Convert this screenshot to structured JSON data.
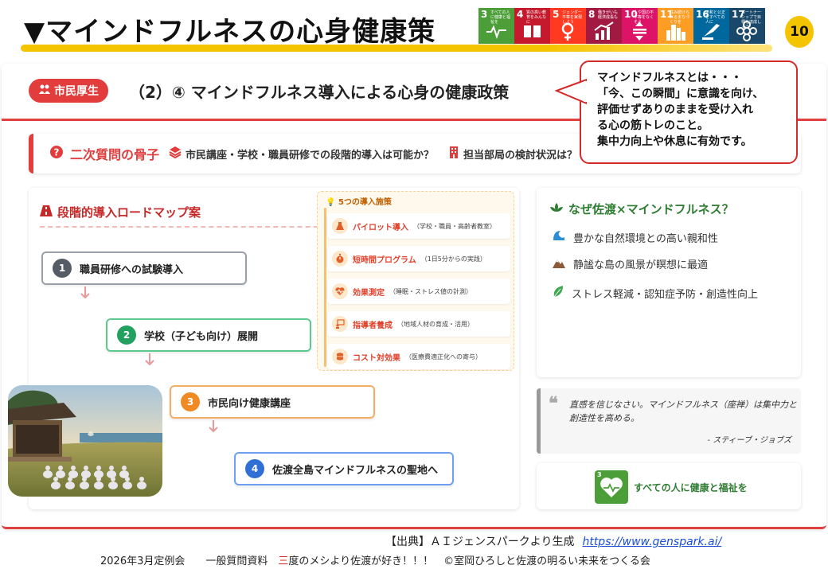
{
  "header": {
    "title": "▼マインドフルネスの心身健康策",
    "page_number": "10",
    "sdgs": [
      {
        "num": "3",
        "text": "すべての人に健康と福祉を",
        "color": "#4c9f38"
      },
      {
        "num": "4",
        "text": "質の高い教育をみんなに",
        "color": "#c5192d"
      },
      {
        "num": "5",
        "text": "ジェンダー平等を実現しよう",
        "color": "#ff3a21"
      },
      {
        "num": "8",
        "text": "働きがいも経済成長も",
        "color": "#a21942"
      },
      {
        "num": "10",
        "text": "人や国の不平等をなくそう",
        "color": "#dd1367"
      },
      {
        "num": "11",
        "text": "住み続けられるまちづくりを",
        "color": "#fd9d24"
      },
      {
        "num": "16",
        "text": "平和と公正をすべての人に",
        "color": "#00689d"
      },
      {
        "num": "17",
        "text": "パートナーシップで目標を達成しよう",
        "color": "#19486a"
      }
    ]
  },
  "slide": {
    "badge": "市民厚生",
    "heading": "（2）④ マインドフルネス導入による心身の健康政策"
  },
  "callout": {
    "lines": [
      "マインドフルネスとは・・・",
      "「今、この瞬間」に意識を向け、",
      "評価せずありのままを受け入れ",
      "る心の筋トレのこと。",
      "集中力向上や休息に有効です。"
    ]
  },
  "question_bar": {
    "label": "二次質問の骨子",
    "item1": "市民講座・学校・職員研修での段階的導入は可能か？",
    "item2": "担当部局の検討状況は？"
  },
  "roadmap": {
    "title": "段階的導入ロードマップ案",
    "steps": [
      {
        "num": "1",
        "label": "職員研修への試験導入",
        "color": "#555c66"
      },
      {
        "num": "2",
        "label": "学校（子ども向け）展開",
        "color": "#22a060"
      },
      {
        "num": "3",
        "label": "市民向け健康講座",
        "color": "#f08a24"
      },
      {
        "num": "4",
        "label": "佐渡全島マインドフルネスの聖地へ",
        "color": "#2f6fd6"
      }
    ]
  },
  "measures": {
    "title": "5つの導入施策",
    "items": [
      {
        "name": "パイロット導入",
        "desc": "（学校・職員・高齢者教室）"
      },
      {
        "name": "短時間プログラム",
        "desc": "（1日5分からの実践）"
      },
      {
        "name": "効果測定",
        "desc": "（睡眠・ストレス値の計測）"
      },
      {
        "name": "指導者養成",
        "desc": "（地域人材の育成・活用）"
      },
      {
        "name": "コスト対効果",
        "desc": "（医療費適正化への寄与）"
      }
    ]
  },
  "why": {
    "title": "なぜ佐渡×マインドフルネス？",
    "items": [
      "豊かな自然環境との高い親和性",
      "静謐な島の風景が瞑想に最適",
      "ストレス軽減・認知症予防・創造性向上"
    ]
  },
  "quote": {
    "text": "直感を信じなさい。マインドフルネス（座禅）は集中力と創造性を高める。",
    "author": "- スティーブ・ジョブズ"
  },
  "sdg3": {
    "num": "3",
    "label": "すべての人に健康と福祉を"
  },
  "footer": {
    "source": "【出典】ＡＩジェンスパークより生成",
    "source_url": "https://www.genspark.ai/",
    "line_prefix": "2026年3月定例会　　一般質問資料　",
    "line_red": "三",
    "line_suffix": "度のメシより佐渡が好き！！！　©室岡ひろしと佐渡の明るい未来をつくる会"
  }
}
